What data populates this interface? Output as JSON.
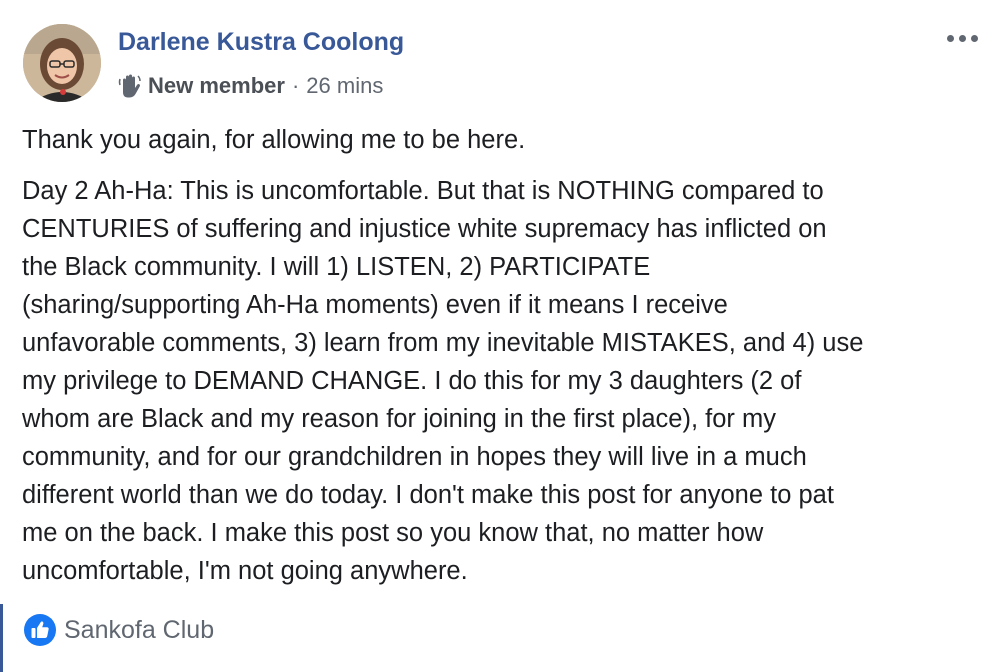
{
  "post": {
    "author": "Darlene Kustra Coolong",
    "badge": "New member",
    "separator": "·",
    "time": "26 mins",
    "paragraph1": "Thank you again, for allowing me to be here.",
    "paragraph2_lines": [
      "Day 2 Ah-Ha: This is uncomfortable. But that is NOTHING compared to",
      "CENTURIES of suffering and injustice white supremacy has inflicted on",
      "the Black community. I will 1) LISTEN, 2) PARTICIPATE",
      "(sharing/supporting Ah-Ha moments) even if it means I receive",
      "unfavorable comments, 3) learn from my inevitable MISTAKES, and 4) use",
      "my privilege to DEMAND CHANGE. I do this for my 3 daughters (2 of",
      "whom are Black and my reason for joining in the first place), for my",
      "community, and for our grandchildren in hopes they will live in a much",
      "different world than we do today. I don't make this post for anyone to pat",
      "me on the back. I make this post so you know that, no matter how",
      "uncomfortable, I'm not going anywhere."
    ]
  },
  "reactions": {
    "icon": "like-icon",
    "label": "Sankofa Club"
  },
  "icons": {
    "more": "more-options-icon",
    "badge": "waving-hand-icon"
  },
  "colors": {
    "author": "#385898",
    "secondary_text": "#606770",
    "body_text": "#1c1e21",
    "like_blue": "#1877f2"
  }
}
